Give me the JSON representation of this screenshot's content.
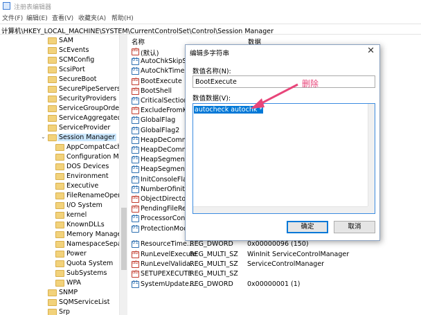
{
  "window": {
    "title": "注册表编辑器"
  },
  "menu": [
    "文件(F)",
    "编辑(E)",
    "查看(V)",
    "收藏夹(A)",
    "帮助(H)"
  ],
  "address": "计算机\\HKEY_LOCAL_MACHINE\\SYSTEM\\CurrentControlSet\\Control\\Session Manager",
  "tree": {
    "items": [
      {
        "label": "SAM"
      },
      {
        "label": "ScEvents"
      },
      {
        "label": "SCMConfig"
      },
      {
        "label": "ScsiPort"
      },
      {
        "label": "SecureBoot"
      },
      {
        "label": "SecurePipeServers"
      },
      {
        "label": "SecurityProviders"
      },
      {
        "label": "ServiceGroupOrder"
      },
      {
        "label": "ServiceAggregatedEv"
      },
      {
        "label": "ServiceProvider"
      },
      {
        "label": "Session Manager"
      },
      {
        "label": "AppCompatCache"
      },
      {
        "label": "Configuration Mar"
      },
      {
        "label": "DOS Devices"
      },
      {
        "label": "Environment"
      },
      {
        "label": "Executive"
      },
      {
        "label": "FileRenameOperat"
      },
      {
        "label": "I/O System"
      },
      {
        "label": "kernel"
      },
      {
        "label": "KnownDLLs"
      },
      {
        "label": "Memory Managen"
      },
      {
        "label": "NamespaceSepara"
      },
      {
        "label": "Power"
      },
      {
        "label": "Quota System"
      },
      {
        "label": "SubSystems"
      },
      {
        "label": "WPA"
      },
      {
        "label": "SNMP"
      },
      {
        "label": "SQMServiceList"
      },
      {
        "label": "Srp"
      }
    ]
  },
  "list": {
    "headers": {
      "name": "名称",
      "data": "数据"
    },
    "rows": [
      {
        "name": "(默认)",
        "type": "",
        "data": ""
      },
      {
        "name": "AutoChkSkipSy",
        "type": "",
        "data": ""
      },
      {
        "name": "AutoChkTimeou",
        "type": "",
        "data": ""
      },
      {
        "name": "BootExecute",
        "type": "",
        "data": ""
      },
      {
        "name": "BootShell",
        "type": "",
        "data": ""
      },
      {
        "name": "CriticalSection",
        "type": "",
        "data": ""
      },
      {
        "name": "ExcludeFromK",
        "type": "",
        "data": ""
      },
      {
        "name": "GlobalFlag",
        "type": "",
        "data": ""
      },
      {
        "name": "GlobalFlag2",
        "type": "",
        "data": ""
      },
      {
        "name": "HeapDeComm",
        "type": "",
        "data": ""
      },
      {
        "name": "HeapDeComm",
        "type": "",
        "data": ""
      },
      {
        "name": "HeapSegment",
        "type": "",
        "data": ""
      },
      {
        "name": "HeapSegment",
        "type": "",
        "data": ""
      },
      {
        "name": "InitConsoleFlag",
        "type": "",
        "data": ""
      },
      {
        "name": "NumberOfiniti",
        "type": "",
        "data": ""
      },
      {
        "name": "ObjectDirector",
        "type": "",
        "data": ""
      },
      {
        "name": "PendingFileRe",
        "type": "",
        "data": ""
      },
      {
        "name": "ProcessorCont",
        "type": "",
        "data": ""
      },
      {
        "name": "ProtectionMode",
        "type": "",
        "data": ""
      },
      {
        "name": "ResourceTime...",
        "type": "REG_DWORD",
        "data": "0x00000096 (150)"
      },
      {
        "name": "RunLevelExecute",
        "type": "REG_MULTI_SZ",
        "data": "WinInit ServiceControlManager"
      },
      {
        "name": "RunLevelValida...",
        "type": "REG_MULTI_SZ",
        "data": "ServiceControlManager"
      },
      {
        "name": "SETUPEXECUTE",
        "type": "REG_MULTI_SZ",
        "data": ""
      },
      {
        "name": "SystemUpdate...",
        "type": "REG_DWORD",
        "data": "0x00000001 (1)"
      }
    ]
  },
  "dialog": {
    "title": "编辑多字符串",
    "close": "✕",
    "name_label": "数值名称(N):",
    "name_value": "BootExecute",
    "data_label": "数值数据(V):",
    "data_value": "autocheck autochk *",
    "ok": "确定",
    "cancel": "取消"
  },
  "annotation": "删除"
}
